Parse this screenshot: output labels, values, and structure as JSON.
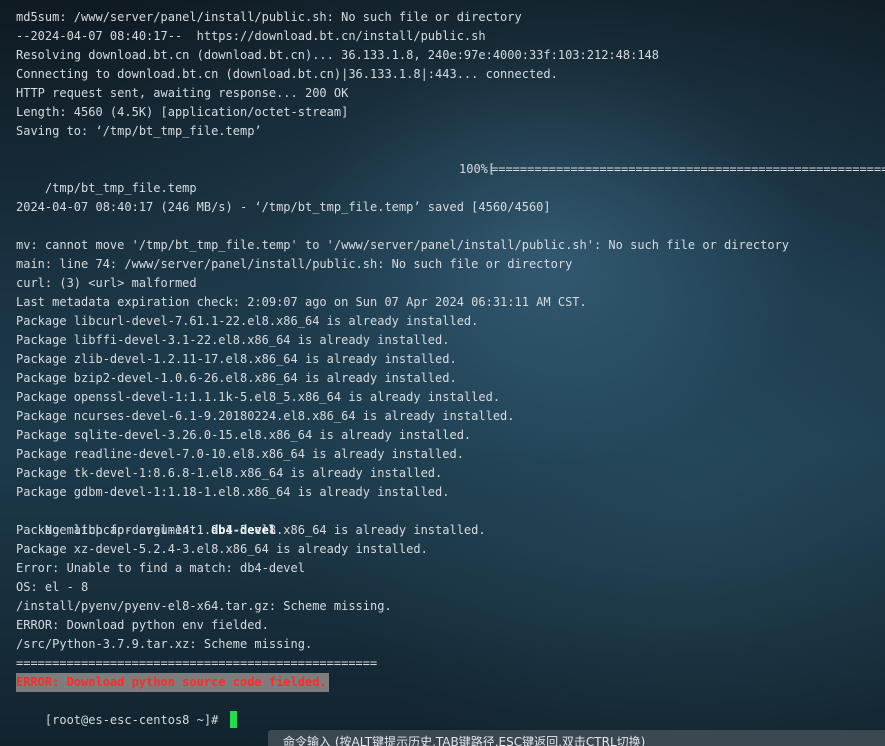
{
  "terminal": {
    "lines": [
      "md5sum: /www/server/panel/install/public.sh: No such file or directory",
      "--2024-04-07 08:40:17--  https://download.bt.cn/install/public.sh",
      "Resolving download.bt.cn (download.bt.cn)... 36.133.1.8, 240e:97e:4000:33f:103:212:48:148",
      "Connecting to download.bt.cn (download.bt.cn)|36.133.1.8|:443... connected.",
      "HTTP request sent, awaiting response... 200 OK",
      "Length: 4560 (4.5K) [application/octet-stream]",
      "Saving to: ‘/tmp/bt_tmp_file.temp’",
      "",
      "",
      "",
      "2024-04-07 08:40:17 (246 MB/s) - ‘/tmp/bt_tmp_file.temp’ saved [4560/4560]",
      "",
      "mv: cannot move '/tmp/bt_tmp_file.temp' to '/www/server/panel/install/public.sh': No such file or directory",
      "main: line 74: /www/server/panel/install/public.sh: No such file or directory",
      "curl: (3) <url> malformed",
      "Last metadata expiration check: 2:09:07 ago on Sun 07 Apr 2024 06:31:11 AM CST.",
      "Package libcurl-devel-7.61.1-22.el8.x86_64 is already installed.",
      "Package libffi-devel-3.1-22.el8.x86_64 is already installed.",
      "Package zlib-devel-1.2.11-17.el8.x86_64 is already installed.",
      "Package bzip2-devel-1.0.6-26.el8.x86_64 is already installed.",
      "Package openssl-devel-1:1.1.1k-5.el8_5.x86_64 is already installed.",
      "Package ncurses-devel-6.1-9.20180224.el8.x86_64 is already installed.",
      "Package sqlite-devel-3.26.0-15.el8.x86_64 is already installed.",
      "Package readline-devel-7.0-10.el8.x86_64 is already installed.",
      "Package tk-devel-1:8.6.8-1.el8.x86_64 is already installed.",
      "Package gdbm-devel-1:1.18-1.el8.x86_64 is already installed.",
      "",
      "Package libpcap-devel-14:1.9.1-5.el8.x86_64 is already installed.",
      "Package xz-devel-5.2.4-3.el8.x86_64 is already installed.",
      "Error: Unable to find a match: db4-devel",
      "OS: el - 8",
      "/install/pyenv/pyenv-el8-x64.tar.gz: Scheme missing.",
      "ERROR: Download python env fielded.",
      "/src/Python-3.7.9.tar.xz: Scheme missing.",
      "=================================================="
    ],
    "progress": {
      "path": "/tmp/bt_tmp_file.temp",
      "percent_text": "100%[",
      "bar": "=====================================================================",
      "percent": 100
    },
    "no_match": {
      "prefix": "No match for argument: ",
      "arg": "db4-devel"
    },
    "error_line": "ERROR: Download python source code fielded.",
    "prompt": "[root@es-esc-centos8 ~]# "
  },
  "hint_bar": {
    "text": "命令输入 (按ALT键提示历史,TAB键路径,ESC键返回,双击CTRL切换)"
  },
  "colors": {
    "error_text": "#ff2a2a",
    "error_bg": "#7d7d7d",
    "cursor": "#22dd4c"
  }
}
